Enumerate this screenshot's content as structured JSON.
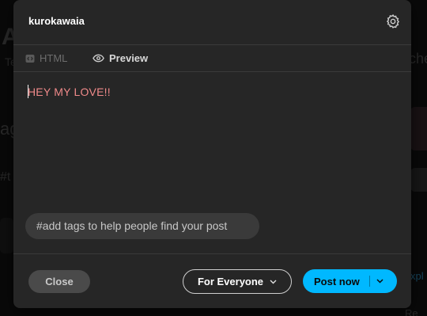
{
  "background": {
    "fragments": [
      "A",
      "Te",
      "ag",
      "#t",
      "che",
      "xpl",
      "Re"
    ]
  },
  "modal": {
    "username": "kurokawaia",
    "tabs": {
      "html_label": "HTML",
      "preview_label": "Preview"
    },
    "post_content": "HEY MY LOVE!!",
    "tags_placeholder": "#add tags to help people find your post",
    "footer": {
      "close_label": "Close",
      "audience_label": "For Everyone",
      "post_label": "Post now"
    }
  },
  "colors": {
    "accent": "#00b8ff",
    "modal_bg": "#262626",
    "content_text": "#f08a8a"
  },
  "icons": [
    "gear-icon",
    "html-code-icon",
    "eye-icon",
    "chevron-down-icon"
  ]
}
